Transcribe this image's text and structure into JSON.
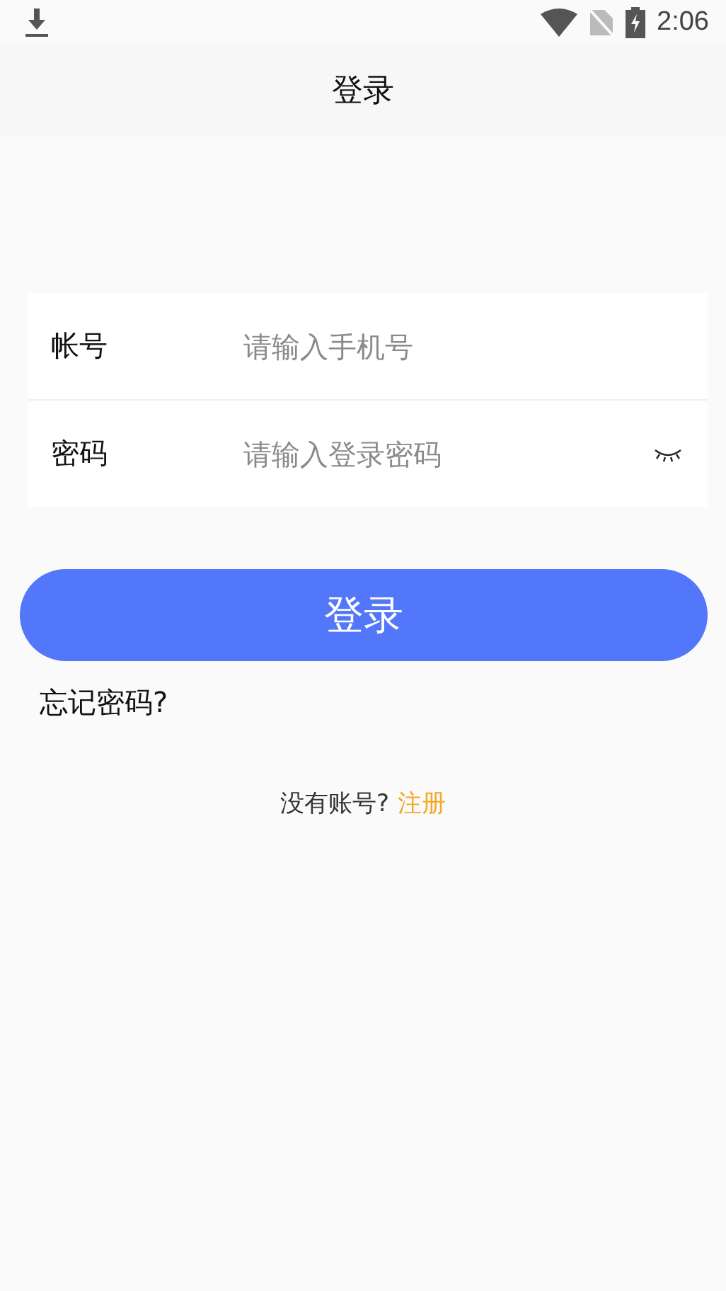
{
  "status_bar": {
    "time": "2:06"
  },
  "header": {
    "title": "登录"
  },
  "fields": [
    {
      "kind": "text",
      "label": "帐号",
      "placeholder": "请输入手机号"
    },
    {
      "kind": "password",
      "label": "密码",
      "placeholder": "请输入登录密码"
    }
  ],
  "login_button": "登录",
  "forgot_link": "忘记密码?",
  "register": {
    "prompt": "没有账号?",
    "link": "注册"
  }
}
